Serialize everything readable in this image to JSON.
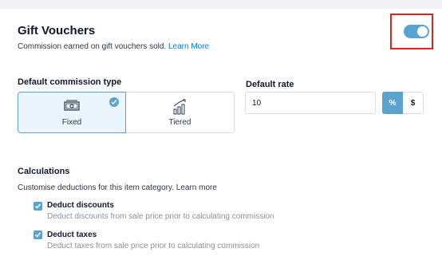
{
  "header": {
    "title": "Gift Vouchers",
    "subtitle": "Commission earned on gift vouchers sold.",
    "learn_more": "Learn More",
    "enabled": true
  },
  "commission_type": {
    "label": "Default commission type",
    "options": [
      {
        "label": "Fixed",
        "icon": "cash-icon",
        "selected": true
      },
      {
        "label": "Tiered",
        "icon": "tiered-chart-icon",
        "selected": false
      }
    ]
  },
  "default_rate": {
    "label": "Default rate",
    "value": "10",
    "units": [
      "%",
      "$"
    ],
    "selected_unit": "%"
  },
  "calculations": {
    "label": "Calculations",
    "description": "Customise deductions for this item category. Learn more",
    "options": [
      {
        "title": "Deduct discounts",
        "description": "Deduct discounts from sale price prior to calculating commission",
        "checked": true
      },
      {
        "title": "Deduct taxes",
        "description": "Deduct taxes from sale price prior to calculating commission",
        "checked": true
      }
    ]
  },
  "colors": {
    "accent": "#5aa3cf",
    "link": "#037aff",
    "highlight_border": "#e3231b"
  }
}
